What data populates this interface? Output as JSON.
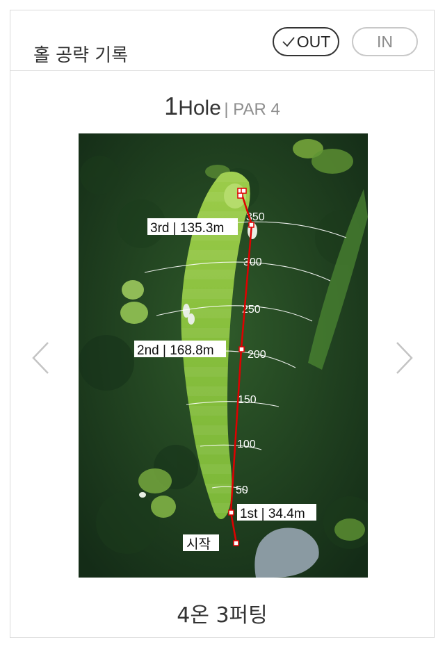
{
  "header": {
    "title": "홀 공략 기록",
    "out_label": "OUT",
    "in_label": "IN",
    "selected": "OUT"
  },
  "hole": {
    "number": "1",
    "word": "Hole",
    "par_text": "| PAR 4"
  },
  "shots": {
    "start": "시작",
    "first": "1st | 34.4m",
    "second": "2nd | 168.8m",
    "third": "3rd | 135.3m"
  },
  "distance_markers": [
    "50",
    "100",
    "150",
    "200",
    "250",
    "300",
    "350"
  ],
  "result": "4온 3퍼팅",
  "colors": {
    "shot_line": "#e00000",
    "fairway": "#8ec63f",
    "rough": "#2f5a2a"
  },
  "icons": {
    "prev": "chevron-left-icon",
    "next": "chevron-right-icon",
    "check": "check-icon"
  }
}
